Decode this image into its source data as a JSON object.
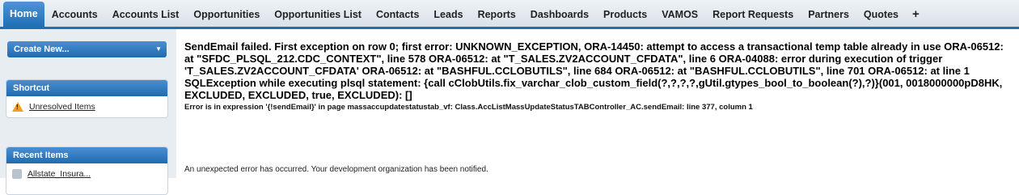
{
  "tabs": [
    {
      "label": "Home",
      "active": true
    },
    {
      "label": "Accounts"
    },
    {
      "label": "Accounts List"
    },
    {
      "label": "Opportunities"
    },
    {
      "label": "Opportunities List"
    },
    {
      "label": "Contacts"
    },
    {
      "label": "Leads"
    },
    {
      "label": "Reports"
    },
    {
      "label": "Dashboards"
    },
    {
      "label": "Products"
    },
    {
      "label": "VAMOS"
    },
    {
      "label": "Report Requests"
    },
    {
      "label": "Partners"
    },
    {
      "label": "Quotes"
    },
    {
      "label": "+"
    }
  ],
  "sidebar": {
    "create_new": "Create New...",
    "shortcut": {
      "title": "Shortcut",
      "item": "Unresolved Items"
    },
    "recent": {
      "title": "Recent Items",
      "item": "Allstate_Insura..."
    }
  },
  "error": {
    "message": "SendEmail failed. First exception on row 0; first error: UNKNOWN_EXCEPTION, ORA-14450: attempt to access a transactional temp table already in use ORA-06512: at \"SFDC_PLSQL_212.CDC_CONTEXT\", line 578 ORA-06512: at \"T_SALES.ZV2ACCOUNT_CFDATA\", line 6 ORA-04088: error during execution of trigger 'T_SALES.ZV2ACCOUNT_CFDATA' ORA-06512: at \"BASHFUL.CCLOBUTILS\", line 684 ORA-06512: at \"BASHFUL.CCLOBUTILS\", line 701 ORA-06512: at line 1 SQLException while executing plsql statement: {call cClobUtils.fix_varchar_clob_custom_field(?,?,?,?,gUtil.gtypes_bool_to_boolean(?),?)}(001, 0018000000pD8HK, EXCLUDED, EXCLUDED, true, EXCLUDED): []",
    "expression": "Error is in expression '{!sendEmail}' in page massaccupdatestatustab_vf: Class.AccListMassUpdateStatusTABController_AC.sendEmail: line 377, column 1",
    "notice": "An unexpected error has occurred. Your development organization has been notified."
  },
  "colors": {
    "accent": "#1f6fb5",
    "warning": "#f0a020"
  }
}
